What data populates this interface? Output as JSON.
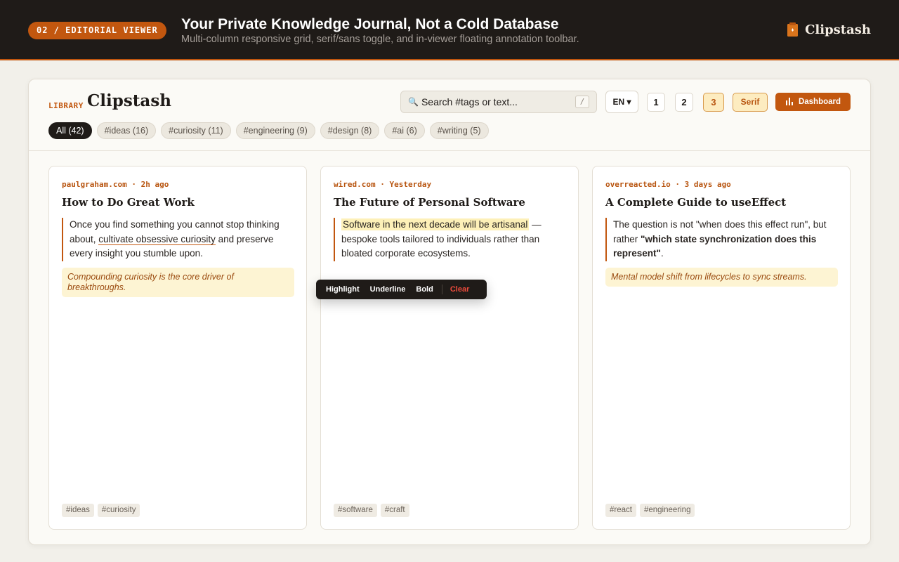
{
  "banner": {
    "badge": "02 / EDITORIAL VIEWER",
    "title": "Your Private Knowledge Journal, Not a Cold Database",
    "subtitle": "Multi-column responsive grid, serif/sans toggle, and in-viewer floating annotation toolbar.",
    "brand": "Clipstash"
  },
  "header": {
    "library_label": "LIBRARY",
    "library_title": "Clipstash",
    "search_placeholder": "Search #tags or text...",
    "search_shortcut": "/",
    "lang": "EN ▾",
    "columns": [
      "1",
      "2",
      "3"
    ],
    "active_columns": "3",
    "font_toggle": "Serif",
    "dashboard_label": "Dashboard"
  },
  "tags": [
    "All (42)",
    "#ideas (16)",
    "#curiosity (11)",
    "#engineering (9)",
    "#design (8)",
    "#ai (6)",
    "#writing (5)"
  ],
  "cards": [
    {
      "meta": "paulgraham.com · 2h ago",
      "title": "How to Do Great Work",
      "quote_pre": "Once you find something you cannot stop thinking about, ",
      "quote_mark": "cultivate obsessive curiosity",
      "quote_post": " and preserve every insight you stumble upon.",
      "note": "Compounding curiosity is the core driver of breakthroughs.",
      "tags": [
        "#ideas",
        "#curiosity"
      ]
    },
    {
      "meta": "wired.com · Yesterday",
      "title": "The Future of Personal Software",
      "quote_mark": "Software in the next decade will be artisanal",
      "quote_post": " — bespoke tools tailored to individuals rather than bloated corporate ecosystems.",
      "tags": [
        "#software",
        "#craft"
      ]
    },
    {
      "meta": "overreacted.io · 3 days ago",
      "title": "A Complete Guide to useEffect",
      "quote_pre": "The question is not \"when does this effect run\", but rather ",
      "quote_mark": "\"which state synchronization does this represent\"",
      "quote_post": ".",
      "note": "Mental model shift from lifecycles to sync streams.",
      "tags": [
        "#react",
        "#engineering"
      ]
    }
  ],
  "toolbar": {
    "highlight": "Highlight",
    "underline": "Underline",
    "bold": "Bold",
    "clear": "Clear"
  },
  "colors": {
    "accent": "#c2570f",
    "dark": "#1f1b18",
    "highlight": "#fdf0b8",
    "clear": "#ef4b3c"
  }
}
